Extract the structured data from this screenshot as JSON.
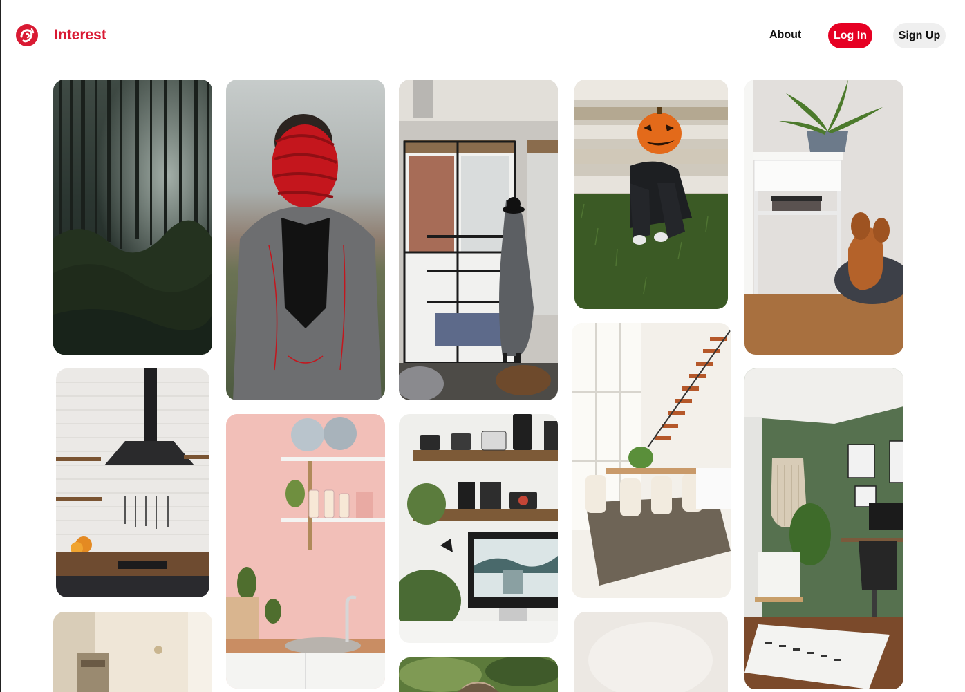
{
  "header": {
    "brand": "Interest",
    "nav": {
      "about": "About",
      "login": "Log In",
      "signup": "Sign Up"
    }
  },
  "colors": {
    "brand_red": "#d91a33",
    "login_bg": "#e60023",
    "signup_bg": "#efefef"
  },
  "icons": {
    "logo": "swirl-logo-icon"
  }
}
